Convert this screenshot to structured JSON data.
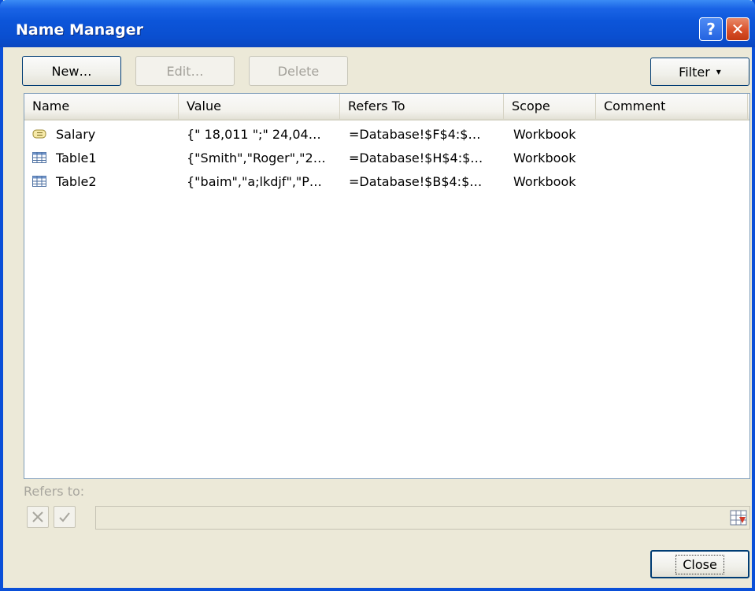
{
  "window": {
    "title": "Name Manager",
    "help_glyph": "?",
    "close_glyph": "✕"
  },
  "toolbar": {
    "new_label": "New…",
    "edit_label": "Edit…",
    "delete_label": "Delete",
    "filter_label": "Filter",
    "filter_arrow": "▾"
  },
  "list": {
    "columns": [
      "Name",
      "Value",
      "Refers To",
      "Scope",
      "Comment"
    ],
    "rows": [
      {
        "icon": "named-range-icon",
        "name": "Salary",
        "value": "{\" 18,011 \";\" 24,04…",
        "refers_to": "=Database!$F$4:$…",
        "scope": "Workbook",
        "comment": ""
      },
      {
        "icon": "table-icon",
        "name": "Table1",
        "value": "{\"Smith\",\"Roger\",\"2…",
        "refers_to": "=Database!$H$4:$…",
        "scope": "Workbook",
        "comment": ""
      },
      {
        "icon": "table-icon",
        "name": "Table2",
        "value": "{\"baim\",\"a;lkdjf\",\"P…",
        "refers_to": "=Database!$B$4:$…",
        "scope": "Workbook",
        "comment": ""
      }
    ]
  },
  "refers": {
    "label": "Refers to:",
    "value": ""
  },
  "footer": {
    "close_label": "Close"
  }
}
